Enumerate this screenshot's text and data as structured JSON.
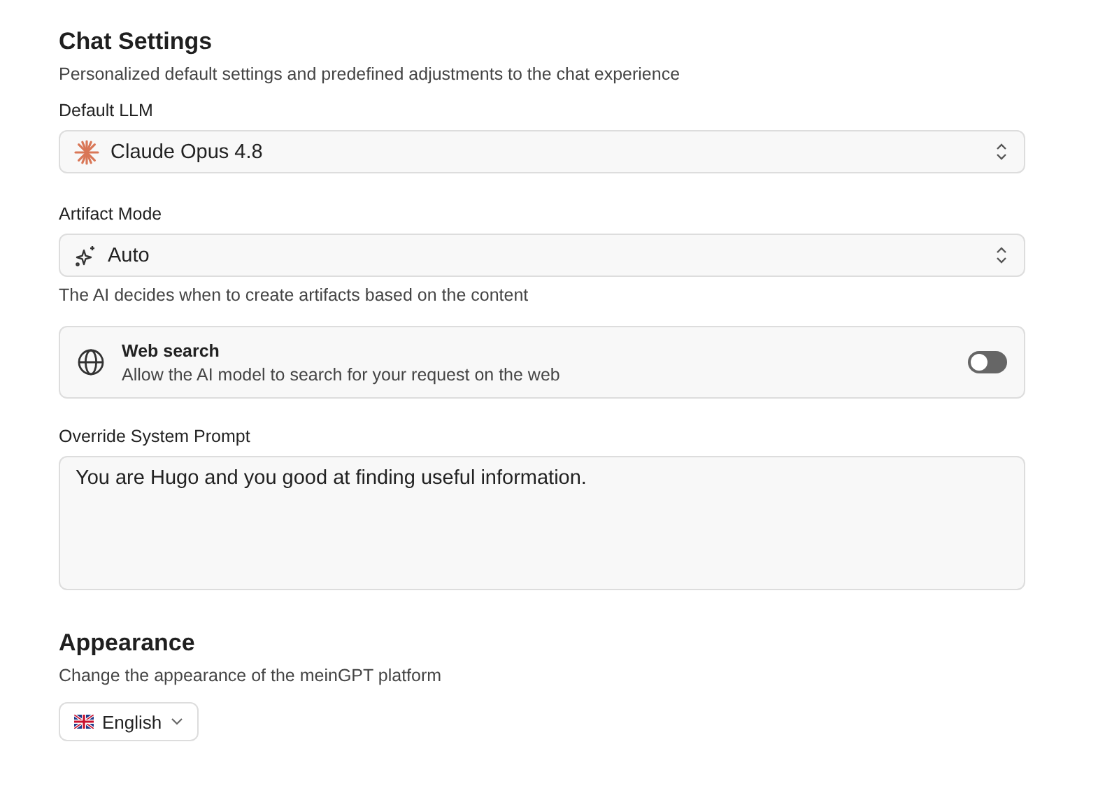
{
  "chat_settings": {
    "title": "Chat Settings",
    "description": "Personalized default settings and predefined adjustments to the chat experience",
    "default_llm": {
      "label": "Default LLM",
      "value": "Claude Opus 4.8"
    },
    "artifact_mode": {
      "label": "Artifact Mode",
      "value": "Auto",
      "hint": "The AI decides when to create artifacts based on the content"
    },
    "web_search": {
      "title": "Web search",
      "description": "Allow the AI model to search for your request on the web",
      "on": false
    },
    "system_prompt": {
      "label": "Override System Prompt",
      "value": "You are Hugo and you good at finding useful information."
    }
  },
  "appearance": {
    "title": "Appearance",
    "description": "Change the appearance of the meinGPT platform",
    "language": "English"
  }
}
